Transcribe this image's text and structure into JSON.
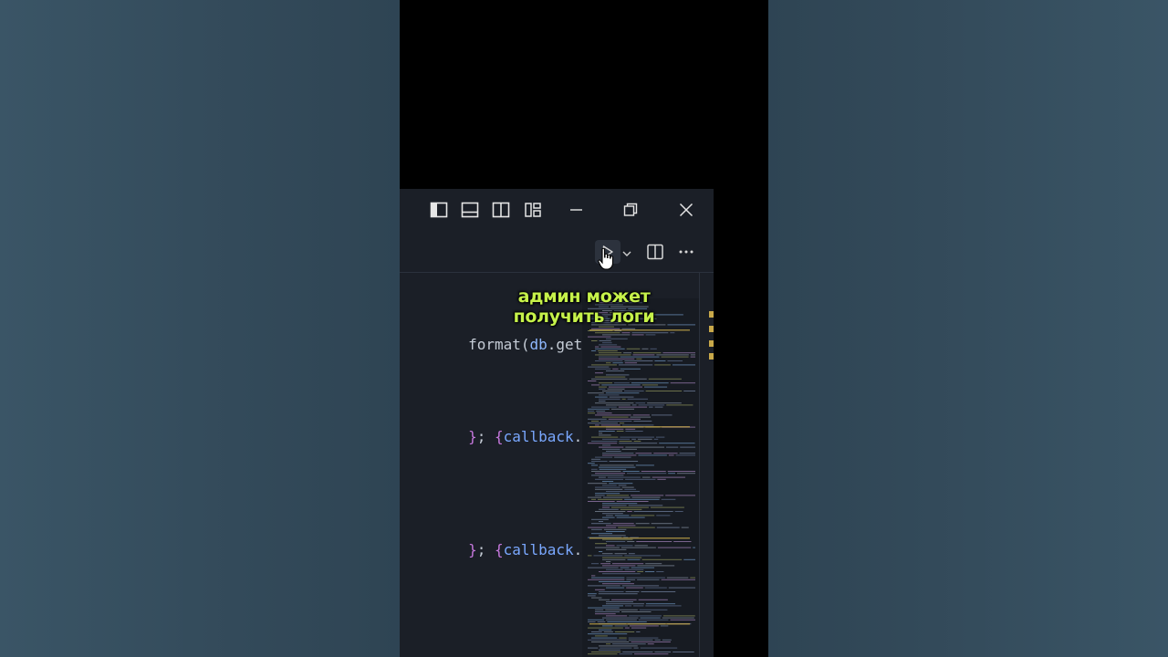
{
  "caption": {
    "line1": "админ может",
    "line2": "получить логи"
  },
  "titlebar": {
    "icons": [
      "toggle-primary-sidebar-icon",
      "toggle-panel-icon",
      "toggle-secondary-sidebar-icon",
      "customize-layout-icon",
      "minimize-icon",
      "restore-icon",
      "close-icon"
    ]
  },
  "toolbar": {
    "icons": [
      "run-icon",
      "chevron-down-icon",
      "split-editor-icon",
      "more-actions-icon"
    ]
  },
  "code": {
    "line1": {
      "fn": "format",
      "paren": "(",
      "obj": "db",
      "rest": ".get_block_"
    },
    "line2": {
      "brace": "}",
      "semi": "; ",
      "brace2": "{",
      "obj": "callback",
      "rest": ".data =",
      "spacer": ""
    },
    "line3": {
      "brace": "}",
      "semi": "; ",
      "brace2": "{",
      "obj": "callback",
      "rest": ".data ="
    }
  },
  "colors": {
    "editor_bg": "#1b1f27",
    "caption": "#c6f24a",
    "keyword_brace": "#c678dd",
    "identifier": "#7aa8ff",
    "minimap_highlight": "#c9a94a"
  }
}
